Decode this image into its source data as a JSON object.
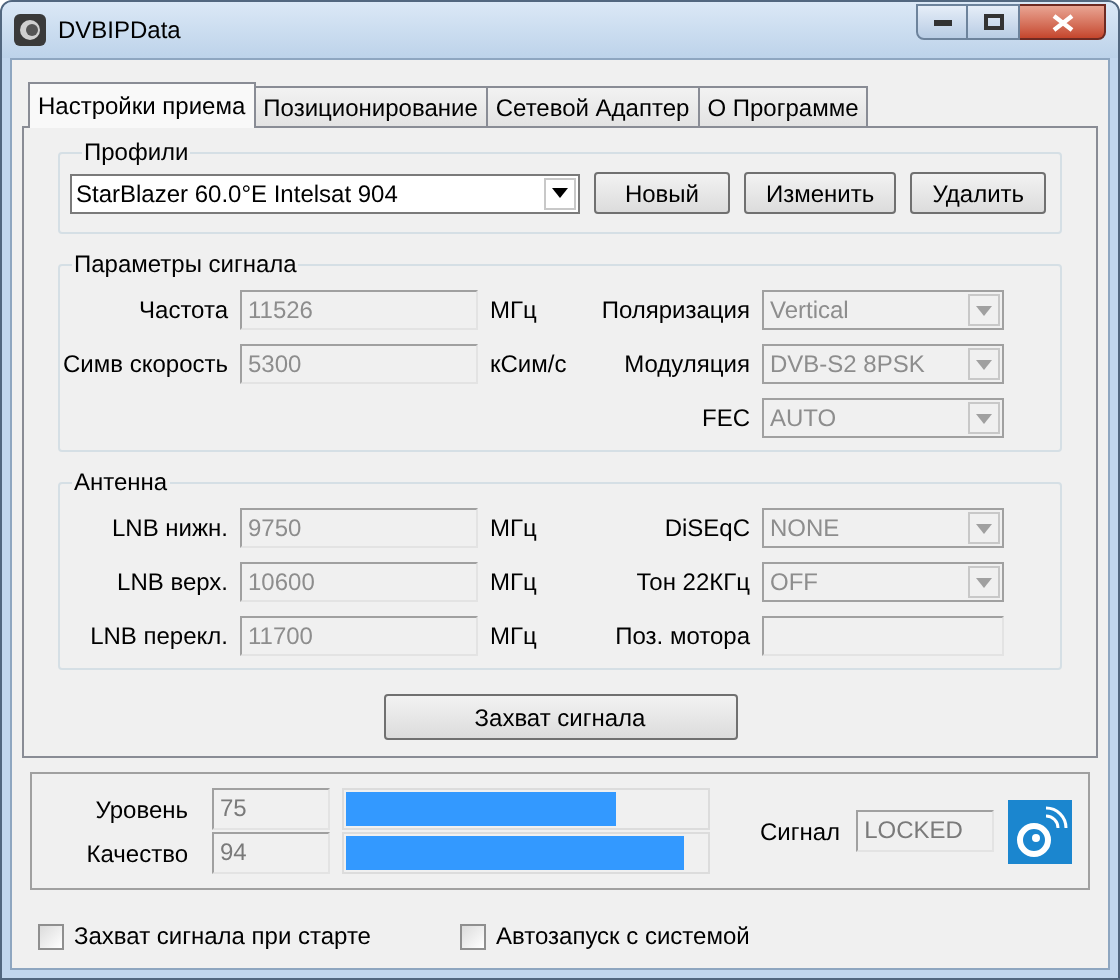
{
  "window": {
    "title": "DVBIPData"
  },
  "tabs": [
    {
      "label": "Настройки приема",
      "selected": true
    },
    {
      "label": "Позиционирование",
      "selected": false
    },
    {
      "label": "Сетевой Адаптер",
      "selected": false
    },
    {
      "label": "О Программе",
      "selected": false
    }
  ],
  "profiles": {
    "title": "Профили",
    "value": "StarBlazer 60.0°E Intelsat 904",
    "buttons": [
      "Новый",
      "Изменить",
      "Удалить"
    ]
  },
  "signal_params": {
    "title": "Параметры сигнала",
    "left": [
      {
        "label": "Частота",
        "value": "11526",
        "unit": "МГц",
        "disabled": true
      },
      {
        "label": "Симв скорость",
        "value": "5300",
        "unit": "кСим/с",
        "disabled": true
      }
    ],
    "right": [
      {
        "kind": "select",
        "label": "Поляризация",
        "value": "Vertical",
        "disabled": true
      },
      {
        "kind": "select",
        "label": "Модуляция",
        "value": "DVB-S2 8PSK",
        "disabled": true
      },
      {
        "kind": "select",
        "label": "FEC",
        "value": "AUTO",
        "disabled": true
      }
    ]
  },
  "antenna": {
    "title": "Антенна",
    "left": [
      {
        "label": "LNB нижн.",
        "value": "9750",
        "unit": "МГц",
        "disabled": true
      },
      {
        "label": "LNB верх.",
        "value": "10600",
        "unit": "МГц",
        "disabled": true
      },
      {
        "label": "LNB перекл.",
        "value": "11700",
        "unit": "МГц",
        "disabled": true
      }
    ],
    "right": [
      {
        "kind": "select",
        "label": "DiSEqC",
        "value": "NONE",
        "disabled": true
      },
      {
        "kind": "select",
        "label": "Тон 22КГц",
        "value": "OFF",
        "disabled": true
      },
      {
        "kind": "field",
        "label": "Поз. мотора",
        "disabled": true
      }
    ]
  },
  "capture_button": "Захват сигнала",
  "meters": [
    {
      "label": "Уровень",
      "value": "75",
      "level": 0.75
    },
    {
      "label": "Качество",
      "value": "94",
      "level": 0.94
    }
  ],
  "signal_status": {
    "label": "Сигнал",
    "value": "LOCKED"
  },
  "options": [
    {
      "label": "Захват сигнала при старте",
      "checked": false
    },
    {
      "label": "Автозапуск с системой",
      "checked": false
    }
  ]
}
